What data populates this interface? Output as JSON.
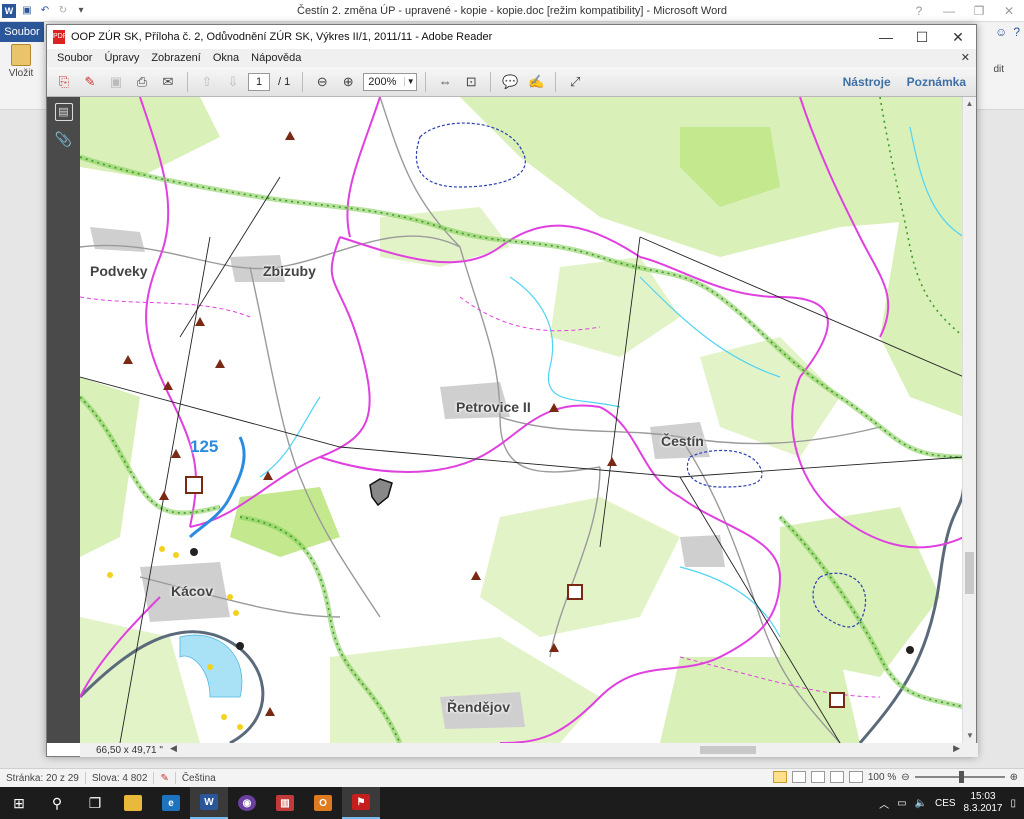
{
  "word": {
    "title": "Čestín 2. změna ÚP - upravené - kopie - kopie.doc [režim kompatibility]  -  Microsoft Word",
    "file_tab": "Soubor",
    "paste_label": "Vložit",
    "ribbon_fragment_right": "dit",
    "status": {
      "page": "Stránka: 20 z 29",
      "words": "Slova: 4 802",
      "language": "Čeština",
      "zoom": "100 %"
    }
  },
  "reader": {
    "title": "OOP ZÚR SK, Příloha č. 2, Odůvodnění ZÚR SK, Výkres II/1, 2011/11 - Adobe Reader",
    "menu": [
      "Soubor",
      "Úpravy",
      "Zobrazení",
      "Okna",
      "Nápověda"
    ],
    "page_current": "1",
    "page_total": "/ 1",
    "zoom": "200%",
    "links": {
      "tools": "Nástroje",
      "comments": "Poznámka"
    },
    "page_size": "66,50 x 49,71 \""
  },
  "map": {
    "places": [
      "Podveky",
      "Zbizuby",
      "Petrovice II",
      "Čestín",
      "Kácov",
      "Řendějov"
    ],
    "road_number": "125"
  },
  "taskbar": {
    "lang": "CES",
    "time": "15:03",
    "date": "8.3.2017"
  },
  "colors": {
    "word_blue": "#2b579a",
    "forest_green": "#d9f0b8",
    "boundary_magenta": "#e040e0",
    "corridor_green": "#6cc24a",
    "river_cyan": "#4fd3f5"
  }
}
